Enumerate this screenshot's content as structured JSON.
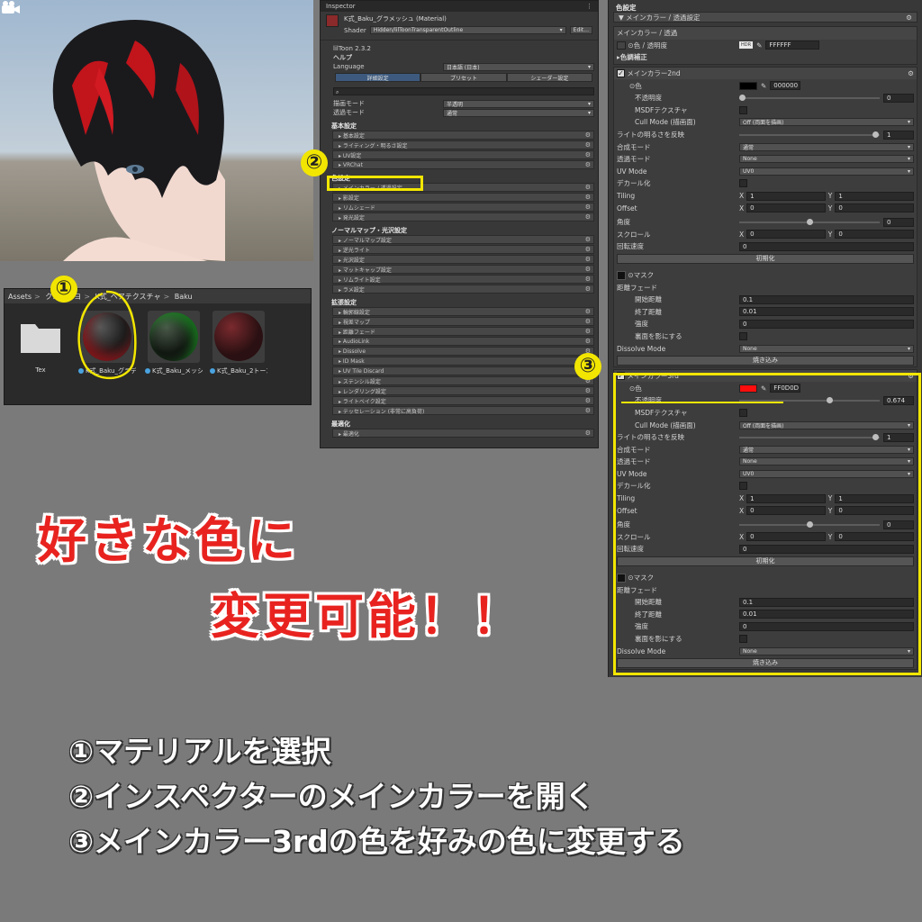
{
  "project": {
    "breadcrumb": [
      "Assets",
      "クロスコヨ",
      "K式_ヘアテクスチャ",
      "Baku"
    ],
    "assets": [
      {
        "name": "Tex",
        "type": "folder"
      },
      {
        "name": "K式_Baku_グラデ",
        "type": "material"
      },
      {
        "name": "K式_Baku_メッシュ",
        "type": "material"
      },
      {
        "name": "K式_Baku_2トーン",
        "type": "material"
      }
    ]
  },
  "inspector": {
    "tab": "Inspector",
    "material_name": "K式_Baku_グラメッシュ (Material)",
    "shader_label": "Shader",
    "shader": "Hidden/lilToonTransparentOutline",
    "edit_label": "Edit...",
    "version": "lilToon 2.3.2",
    "help": "ヘルプ",
    "language_label": "Language",
    "language": "日本語 (日本)",
    "tabs": [
      "詳細設定",
      "プリセット",
      "シェーダー設定"
    ],
    "render_mode_label": "描画モード",
    "render_mode": "半透明",
    "transparent_mode_label": "透過モード",
    "transparent_mode": "通常",
    "sections": [
      {
        "title": "基本設定",
        "items": [
          "基本設定",
          "ライティング・明るさ設定",
          "UV設定",
          "VRChat"
        ]
      },
      {
        "title": "色設定",
        "items": [
          "メインカラー / 透過設定",
          "影設定",
          "リムシェード",
          "発光設定"
        ]
      },
      {
        "title": "ノーマルマップ・光沢設定",
        "items": [
          "ノーマルマップ設定",
          "逆光ライト",
          "光沢設定",
          "マットキャップ設定",
          "リムライト設定",
          "ラメ設定"
        ]
      },
      {
        "title": "拡張設定",
        "items": [
          "輪郭線設定",
          "視差マップ",
          "距離フェード",
          "AudioLink",
          "Dissolve",
          "ID Mask",
          "UV Tile Discard",
          "ステンシル設定",
          "レンダリング設定",
          "ライトベイク設定",
          "テッセレーション (非常に高負荷)"
        ]
      },
      {
        "title": "最適化",
        "items": [
          "最適化"
        ]
      }
    ]
  },
  "colors": {
    "title": "色設定",
    "group": "メインカラー / 透過設定",
    "main": {
      "header": "メインカラー / 透過",
      "color_label": "色 / 透明度",
      "hdr": "HDR",
      "hex": "FFFFFF",
      "correction": "色調補正"
    },
    "second": {
      "header": "メインカラー2nd",
      "color_label": "色",
      "hex": "000000",
      "opacity_label": "不透明度",
      "opacity": "0",
      "msdf_label": "MSDFテクスチャ",
      "cull_label": "Cull Mode (描画面)",
      "cull": "Off (両面を描画)",
      "invert_label": "ライトの明るさを反映",
      "invert": "1",
      "blend_label": "合成モード",
      "blend": "通常",
      "trans_label": "透過モード",
      "trans": "None",
      "uv_label": "UV Mode",
      "uv": "UV0",
      "decal_label": "デカール化",
      "tiling_label": "Tiling",
      "tiling_x": "1",
      "tiling_y": "1",
      "offset_label": "Offset",
      "offset_x": "0",
      "offset_y": "0",
      "angle_label": "角度",
      "angle": "0",
      "scroll_label": "スクロール",
      "scroll_x": "0",
      "scroll_y": "0",
      "rot_label": "回転速度",
      "rot": "0",
      "reset": "初期化",
      "mask_label": "マスク",
      "fade_label": "距離フェード",
      "start_label": "開始距離",
      "start": "0.1",
      "end_label": "終了距離",
      "end": "0.01",
      "strength_label": "強度",
      "strength": "0",
      "back_label": "裏面を影にする",
      "dissolve_label": "Dissolve Mode",
      "dissolve": "None",
      "bake": "焼き込み"
    },
    "third": {
      "header": "メインカラー3rd",
      "color_label": "色",
      "hex": "FF0D0D",
      "opacity_label": "不透明度",
      "opacity": "0.674",
      "msdf_label": "MSDFテクスチャ",
      "cull_label": "Cull Mode (描画面)",
      "cull": "Off (両面を描画)",
      "invert_label": "ライトの明るさを反映",
      "invert": "1",
      "blend_label": "合成モード",
      "blend": "通常",
      "trans_label": "透過モード",
      "trans": "None",
      "uv_label": "UV Mode",
      "uv": "UV0",
      "decal_label": "デカール化",
      "tiling_label": "Tiling",
      "tiling_x": "1",
      "tiling_y": "1",
      "offset_label": "Offset",
      "offset_x": "0",
      "offset_y": "0",
      "angle_label": "角度",
      "angle": "0",
      "scroll_label": "スクロール",
      "scroll_x": "0",
      "scroll_y": "0",
      "rot_label": "回転速度",
      "rot": "0",
      "reset": "初期化",
      "mask_label": "マスク",
      "fade_label": "距離フェード",
      "start_label": "開始距離",
      "start": "0.1",
      "end_label": "終了距離",
      "end": "0.01",
      "strength_label": "強度",
      "strength": "0",
      "back_label": "裏面を影にする",
      "dissolve_label": "Dissolve Mode",
      "dissolve": "None",
      "bake": "焼き込み"
    }
  },
  "markers": [
    "①",
    "②",
    "③"
  ],
  "caption": {
    "line1": "好きな色に",
    "line2": "変更可能！！"
  },
  "steps": [
    "①マテリアルを選択",
    "②インスペクターのメインカラーを開く",
    "③メインカラー3rdの色を好みの色に変更する"
  ],
  "palette": {
    "accent_yellow": "#f2e600",
    "caption_red": "#e8231f",
    "third_color": "#FF0D0D"
  }
}
